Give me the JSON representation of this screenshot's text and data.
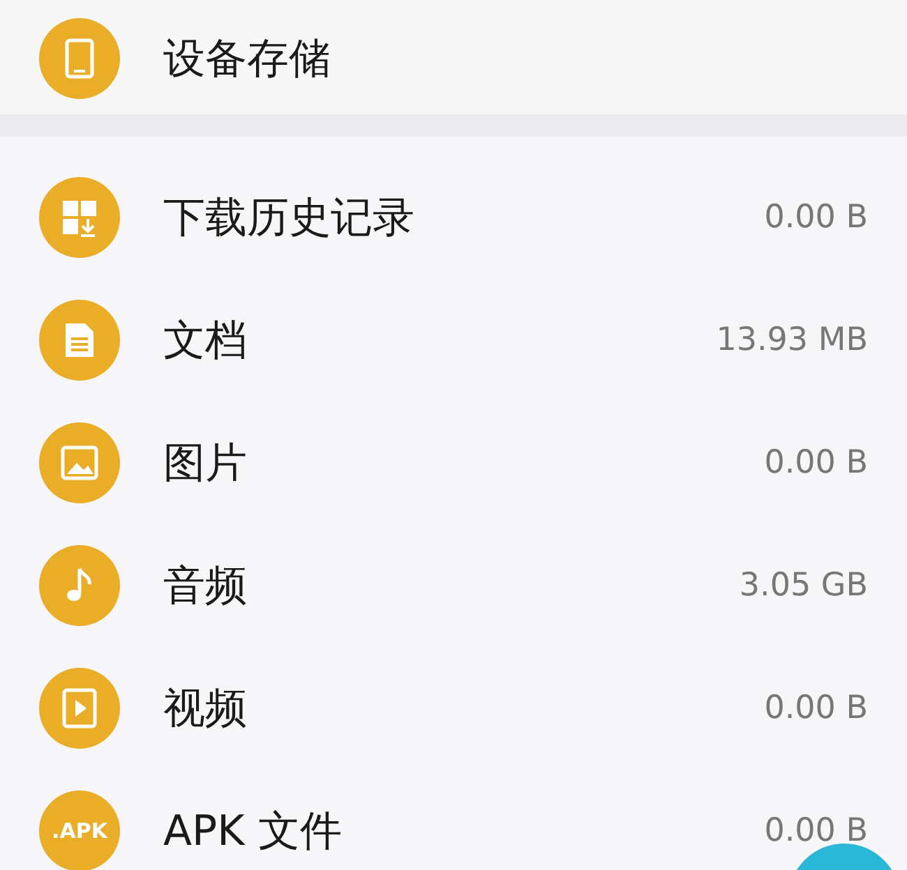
{
  "storage": {
    "label": "设备存储"
  },
  "categories": [
    {
      "kind": "downloads",
      "label": "下载历史记录",
      "size": "0.00 B"
    },
    {
      "kind": "documents",
      "label": "文档",
      "size": "13.93 MB"
    },
    {
      "kind": "images",
      "label": "图片",
      "size": "0.00 B"
    },
    {
      "kind": "audio",
      "label": "音频",
      "size": "3.05 GB"
    },
    {
      "kind": "videos",
      "label": "视频",
      "size": "0.00 B"
    },
    {
      "kind": "apk",
      "label": "APK 文件",
      "size": "0.00 B",
      "icon_text": ".APK"
    }
  ]
}
